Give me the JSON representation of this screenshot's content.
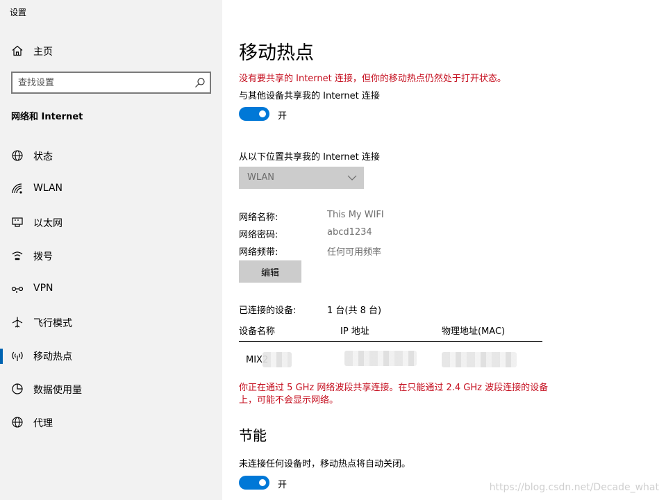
{
  "app": {
    "title": "设置"
  },
  "sidebar": {
    "home_label": "主页",
    "search_placeholder": "查找设置",
    "section_title": "网络和 Internet",
    "items": [
      {
        "label": "状态",
        "icon": "globe-status-icon",
        "active": false
      },
      {
        "label": "WLAN",
        "icon": "wifi-icon",
        "active": false
      },
      {
        "label": "以太网",
        "icon": "ethernet-icon",
        "active": false
      },
      {
        "label": "拨号",
        "icon": "dialup-icon",
        "active": false
      },
      {
        "label": "VPN",
        "icon": "vpn-icon",
        "active": false
      },
      {
        "label": "飞行模式",
        "icon": "airplane-icon",
        "active": false
      },
      {
        "label": "移动热点",
        "icon": "hotspot-icon",
        "active": true
      },
      {
        "label": "数据使用量",
        "icon": "data-usage-icon",
        "active": false
      },
      {
        "label": "代理",
        "icon": "proxy-globe-icon",
        "active": false
      }
    ]
  },
  "main": {
    "title": "移动热点",
    "warning_top": "没有要共享的 Internet 连接，但你的移动热点仍然处于打开状态。",
    "share_label": "与其他设备共享我的 Internet 连接",
    "share_toggle": {
      "state": "开",
      "on": true
    },
    "share_from_label": "从以下位置共享我的 Internet 连接",
    "share_from_value": "WLAN",
    "network_info": {
      "name_key": "网络名称:",
      "name_val": "This My WIFI",
      "password_key": "网络密码:",
      "password_val": "abcd1234",
      "band_key": "网络频带:",
      "band_val": "任何可用频率"
    },
    "edit_button": "编辑",
    "connected_key": "已连接的设备:",
    "connected_val": "1 台(共 8 台)",
    "table": {
      "headers": [
        "设备名称",
        "IP 地址",
        "物理地址(MAC)"
      ],
      "rows": [
        {
          "device": "MIX2"
        }
      ]
    },
    "warning_band": "你正在通过 5 GHz 网络波段共享连接。在只能通过 2.4 GHz 波段连接的设备上，可能不会显示网络。",
    "power_section": "节能",
    "power_desc": "未连接任何设备时，移动热点将自动关闭。",
    "power_toggle": {
      "state": "开",
      "on": true
    }
  },
  "watermark": "https://blog.csdn.net/Decade_what",
  "colors": {
    "accent": "#0078d7",
    "warning": "#c50f1f",
    "sidebar_bg": "#f2f2f2",
    "disabled_bg": "#cccccc"
  }
}
